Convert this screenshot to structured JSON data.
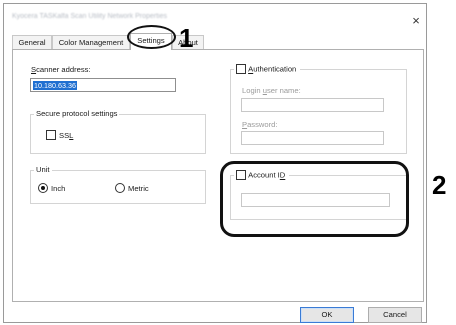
{
  "window": {
    "title": "Kyocera TASKalfa Scan Utility Network Properties",
    "close_glyph": "×"
  },
  "tabs": [
    {
      "label": "General"
    },
    {
      "label": "Color Management"
    },
    {
      "label": "Settings",
      "active": true
    },
    {
      "label": "About"
    }
  ],
  "scanner": {
    "label_pre": "",
    "label_key": "S",
    "label_post": "canner address:",
    "value": "10.180.63.36"
  },
  "secure_protocol": {
    "group_label": "Secure protocol settings",
    "ssl_label_pre": "SS",
    "ssl_label_key": "L",
    "ssl_checked": false
  },
  "unit": {
    "group_label": "Unit",
    "options": [
      {
        "label": "Inch",
        "selected": true
      },
      {
        "label": "Metric",
        "selected": false
      }
    ]
  },
  "authentication": {
    "checkbox_label_pre": "",
    "checkbox_label_key": "A",
    "checkbox_label_post": "uthentication",
    "checked": false,
    "login_label_pre": "Login ",
    "login_label_key": "u",
    "login_label_post": "ser name:",
    "login_value": "",
    "password_label_pre": "",
    "password_label_key": "P",
    "password_label_post": "assword:",
    "password_value": ""
  },
  "account": {
    "checkbox_label_pre": "Account I",
    "checkbox_label_key": "D",
    "checked": false,
    "value": ""
  },
  "buttons": {
    "ok": "OK",
    "cancel": "Cancel"
  },
  "callouts": {
    "one": "1",
    "two": "2"
  }
}
